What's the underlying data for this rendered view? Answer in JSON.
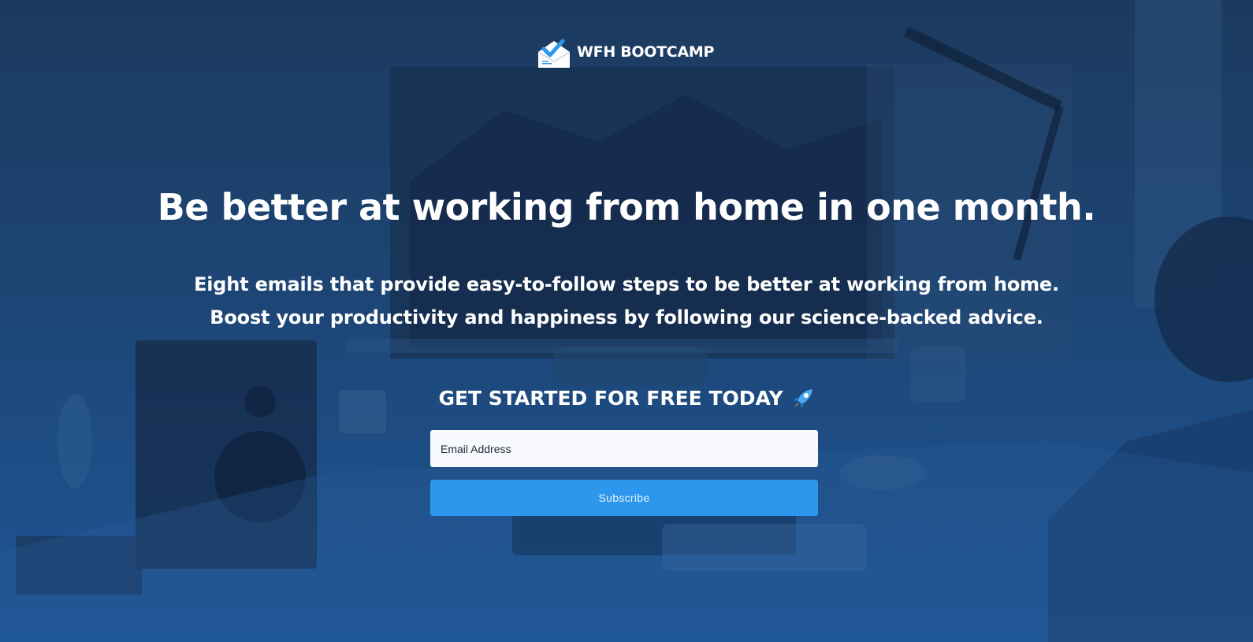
{
  "brand": {
    "name": "WFH BOOTCAMP",
    "logo_icon": "envelope-check-icon"
  },
  "hero": {
    "headline": "Be better at working from home in one month.",
    "subhead_lines": [
      "Eight emails that provide easy-to-follow steps to be better at working from home.",
      "Boost your productivity and happiness by following our science-backed advice."
    ]
  },
  "signup": {
    "cta": "GET STARTED FOR FREE TODAY",
    "cta_icon": "rocket-icon",
    "email_placeholder": "Email Address",
    "email_value": "",
    "button_label": "Subscribe"
  },
  "colors": {
    "overlay_top": "#1c3a5f",
    "overlay_bottom": "#1e5698",
    "button": "#2c97ec",
    "input_bg": "#f7f9fc"
  }
}
